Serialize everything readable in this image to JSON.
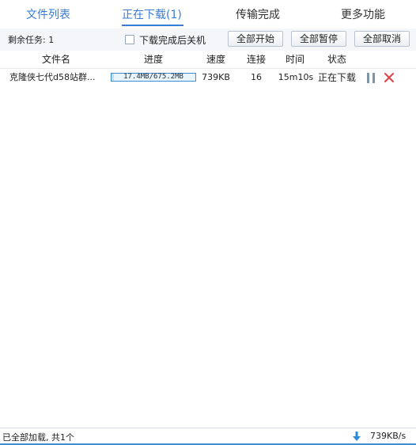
{
  "tabs": [
    {
      "label": "文件列表"
    },
    {
      "label": "正在下载(1)"
    },
    {
      "label": "传输完成"
    },
    {
      "label": "更多功能"
    }
  ],
  "toolbar": {
    "remaining": "剩余任务: 1",
    "shutdown_label": "下载完成后关机",
    "start_all": "全部开始",
    "pause_all": "全部暂停",
    "cancel_all": "全部取消"
  },
  "columns": {
    "name": "文件名",
    "progress": "进度",
    "speed": "速度",
    "connections": "连接",
    "time": "时间",
    "status": "状态"
  },
  "rows": [
    {
      "name": "克隆侠七代d58站群...",
      "progress_text": "17.4MB/675.2MB",
      "progress_fraction": 0.026,
      "speed": "739KB",
      "connections": "16",
      "time": "15m10s",
      "status": "正在下载"
    }
  ],
  "statusbar": {
    "text": "已全部加载, 共1个",
    "total_speed": "739KB/s"
  },
  "colors": {
    "accent": "#3a7bd5",
    "progress_border": "#3f8ecf",
    "cancel_red": "#e0404a",
    "pause_gray": "#7d95a8"
  }
}
